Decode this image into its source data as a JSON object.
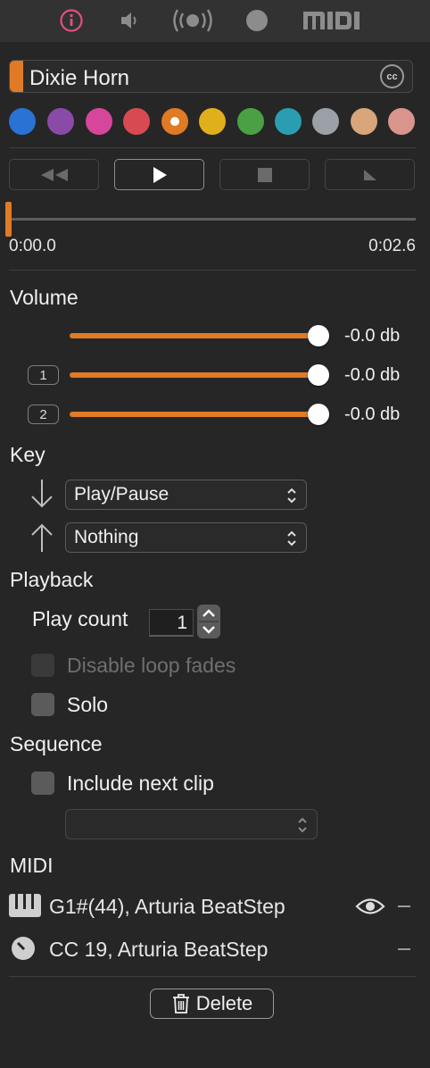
{
  "colors": {
    "accent": "#e07a25",
    "info_tab_active": "#e0507f",
    "swatches": [
      "#2a72d4",
      "#8a4ba8",
      "#d6469a",
      "#d84a52",
      "#e07a25",
      "#e0b01c",
      "#4aa043",
      "#2a9eb0",
      "#9aa0a6",
      "#d9a57a",
      "#d9948e"
    ]
  },
  "tabs": [
    {
      "icon": "info-icon",
      "active": true
    },
    {
      "icon": "speaker-icon",
      "active": false
    },
    {
      "icon": "broadcast-icon",
      "active": false
    },
    {
      "icon": "record-dot-icon",
      "active": false
    },
    {
      "icon": "midi-logo-icon",
      "label": "MIDI",
      "active": false
    }
  ],
  "clip": {
    "name": "Dixie Horn",
    "cc_icon": "cc-icon",
    "selected_color_index": 4
  },
  "transport": {
    "buttons": [
      "rewind-icon",
      "play-icon",
      "stop-icon",
      "fade-out-icon"
    ],
    "active_button_index": 1,
    "position_fraction": 0.0,
    "time_start": "0:00.0",
    "time_end": "0:02.6"
  },
  "volume": {
    "title": "Volume",
    "rows": [
      {
        "badge": "",
        "value": "-0.0 db",
        "level": 1.0
      },
      {
        "badge": "1",
        "value": "-0.0 db",
        "level": 1.0
      },
      {
        "badge": "2",
        "value": "-0.0 db",
        "level": 1.0
      }
    ]
  },
  "key": {
    "title": "Key",
    "down_icon": "arrow-down-icon",
    "up_icon": "arrow-up-icon",
    "down_action": "Play/Pause",
    "up_action": "Nothing"
  },
  "playback": {
    "title": "Playback",
    "play_count_label": "Play count",
    "play_count_value": "1",
    "disable_loop_fades_label": "Disable loop fades",
    "disable_loop_fades_checked": false,
    "disable_loop_fades_enabled": false,
    "solo_label": "Solo",
    "solo_checked": false
  },
  "sequence": {
    "title": "Sequence",
    "include_next_label": "Include next clip",
    "include_next_checked": false,
    "next_clip_value": ""
  },
  "midi": {
    "title": "MIDI",
    "mappings": [
      {
        "icon": "piano-keys-icon",
        "text": "G1#(44), Arturia BeatStep",
        "has_eye": true
      },
      {
        "icon": "knob-icon",
        "text": "CC 19, Arturia BeatStep",
        "has_eye": false
      }
    ]
  },
  "delete_label": "Delete",
  "delete_icon": "trash-icon"
}
